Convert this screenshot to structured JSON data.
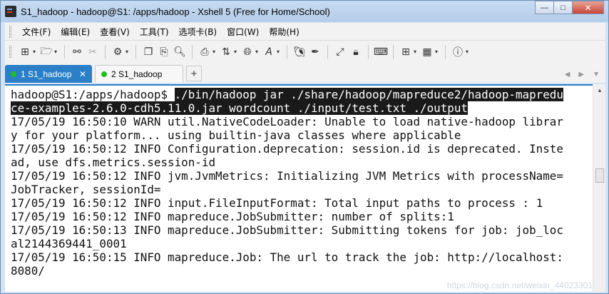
{
  "window": {
    "title": "S1_hadoop - hadoop@S1: /apps/hadoop - Xshell 5 (Free for Home/School)"
  },
  "menu": [
    {
      "label": "文件(F)"
    },
    {
      "label": "编辑(E)"
    },
    {
      "label": "查看(V)"
    },
    {
      "label": "工具(T)"
    },
    {
      "label": "选项卡(B)"
    },
    {
      "label": "窗口(W)"
    },
    {
      "label": "帮助(H)"
    }
  ],
  "tabs": [
    {
      "label": "1 S1_hadoop",
      "active": true,
      "status_color": "#21c021"
    },
    {
      "label": "2 S1_hadoop",
      "active": false,
      "status_color": "#21c021"
    }
  ],
  "terminal": {
    "prompt": "hadoop@S1:/apps/hadoop$ ",
    "command_line1": "./bin/hadoop jar ./share/hadoop/mapreduce2/hadoop-mapredu",
    "command_line2": "ce-examples-2.6.0-cdh5.11.0.jar wordcount ./input/test.txt ./output",
    "lines": [
      "17/05/19 16:50:10 WARN util.NativeCodeLoader: Unable to load native-hadoop librar",
      "y for your platform... using builtin-java classes where applicable",
      "17/05/19 16:50:12 INFO Configuration.deprecation: session.id is deprecated. Inste",
      "ad, use dfs.metrics.session-id",
      "17/05/19 16:50:12 INFO jvm.JvmMetrics: Initializing JVM Metrics with processName=",
      "JobTracker, sessionId=",
      "17/05/19 16:50:12 INFO input.FileInputFormat: Total input paths to process : 1",
      "17/05/19 16:50:12 INFO mapreduce.JobSubmitter: number of splits:1",
      "17/05/19 16:50:13 INFO mapreduce.JobSubmitter: Submitting tokens for job: job_loc",
      "al2144369441_0001",
      "17/05/19 16:50:15 INFO mapreduce.Job: The url to track the job: http://localhost:",
      "8080/"
    ]
  },
  "watermark": "https://blog.csdn.net/weixin_44023301",
  "colors": {
    "accent": "#2a7fc6",
    "selection": "#1a1a1a"
  }
}
